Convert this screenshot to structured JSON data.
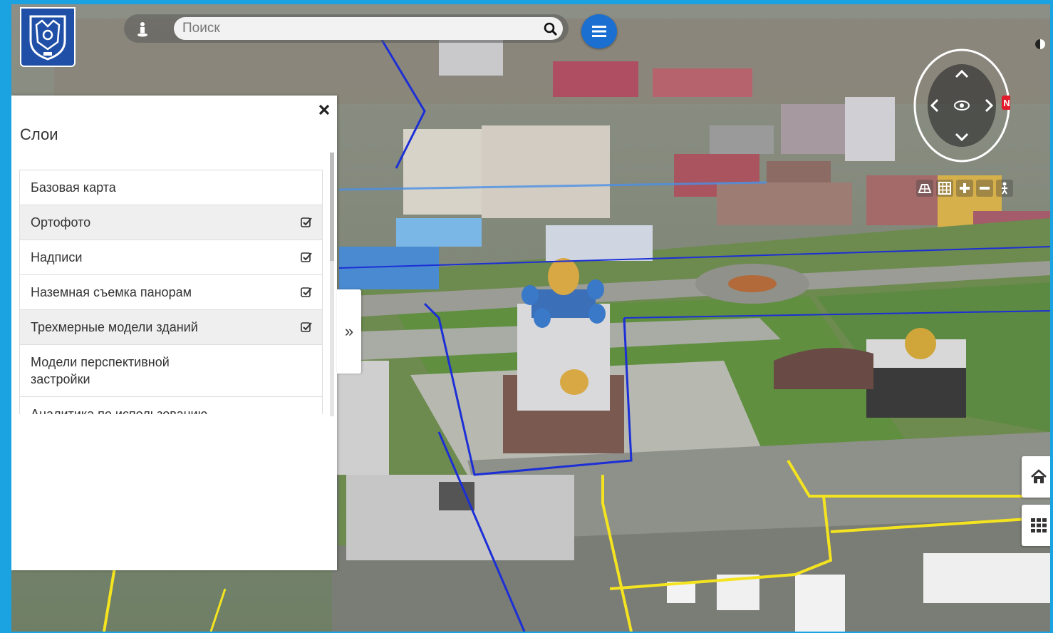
{
  "search": {
    "placeholder": "Поиск"
  },
  "layers_panel": {
    "title": "Слои",
    "items": [
      {
        "label": "Базовая карта",
        "checked": false,
        "shaded": false
      },
      {
        "label": "Ортофото",
        "checked": true,
        "shaded": true
      },
      {
        "label": "Надписи",
        "checked": true,
        "shaded": false
      },
      {
        "label": "Наземная съемка панорам",
        "checked": true,
        "shaded": false
      },
      {
        "label": "Трехмерные модели зданий",
        "checked": true,
        "shaded": true
      },
      {
        "label": "Модели перспективной застройки",
        "checked": false,
        "shaded": false
      },
      {
        "label": "Аналитика по использованию",
        "checked": false,
        "shaded": false
      }
    ],
    "collapse_glyph": "»"
  },
  "compass": {
    "north_label": "N"
  },
  "icons": {
    "logo": "city-coat-of-arms-icon",
    "pin": "street-view-pin-icon",
    "search": "search-icon",
    "menu": "hamburger-menu-icon",
    "close": "close-icon",
    "home": "home-icon",
    "grid": "grid-apps-icon"
  },
  "colors": {
    "frame": "#1aa3e0",
    "menu_button": "#1b6fd0",
    "logo_bg": "#1f4fa6"
  }
}
